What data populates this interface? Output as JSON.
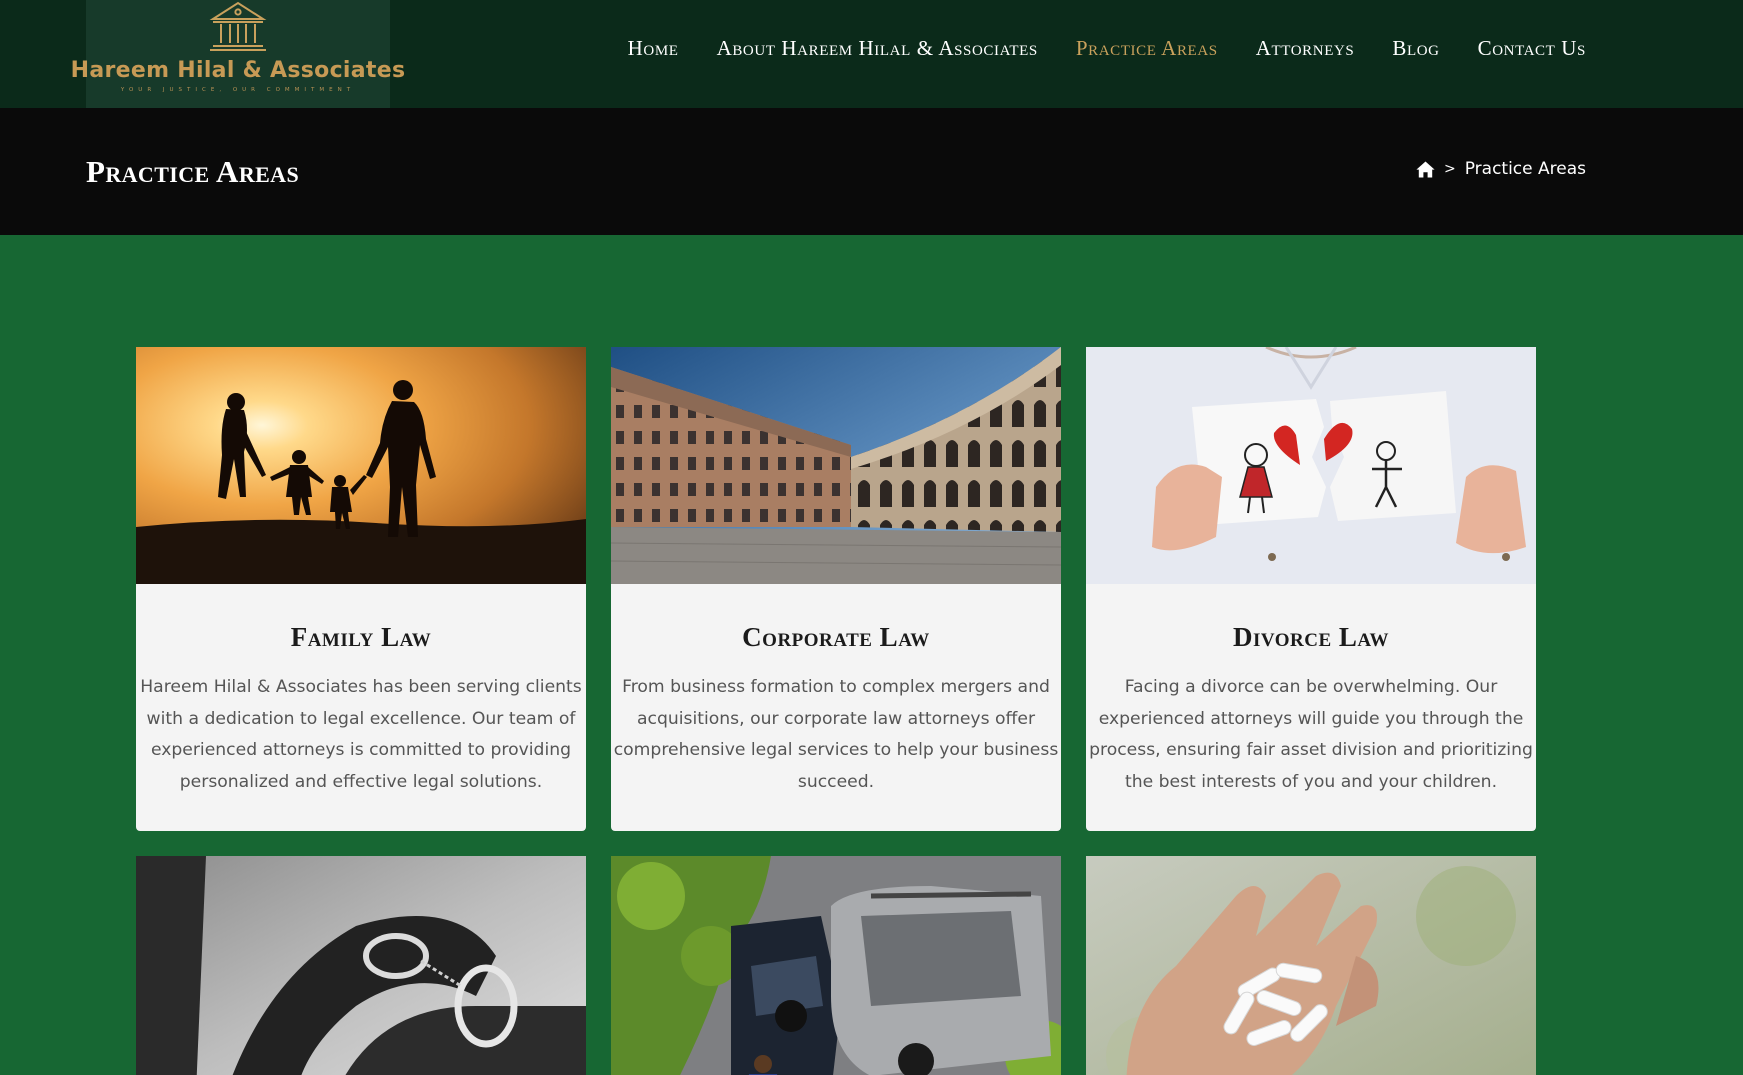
{
  "header": {
    "logo_name": "Hareem Hilal & Associates",
    "logo_tagline": "YOUR JUSTICE, OUR COMMITMENT",
    "logo_icon": "courthouse-icon",
    "nav": [
      {
        "label": "Home",
        "active": false
      },
      {
        "label": "About Hareem Hilal & Associates",
        "active": false
      },
      {
        "label": "Practice Areas",
        "active": true
      },
      {
        "label": "Attorneys",
        "active": false
      },
      {
        "label": "Blog",
        "active": false
      },
      {
        "label": "Contact Us",
        "active": false
      }
    ]
  },
  "title_band": {
    "title": "Practice Areas",
    "breadcrumb": {
      "home_icon": "home-icon",
      "separator": ">",
      "current": "Practice Areas"
    }
  },
  "cards": [
    {
      "title": "Family Law",
      "text": "Hareem Hilal & Associates has been serving clients with a dedication to legal excellence. Our team of experienced attorneys is committed to providing personalized and effective legal solutions.",
      "image": "family-silhouette-sunset"
    },
    {
      "title": "Corporate Law",
      "text": "From business formation to complex mergers and acquisitions, our corporate law attorneys offer comprehensive legal services to help your business succeed.",
      "image": "palace-courtyard"
    },
    {
      "title": "Divorce Law",
      "text": "Facing a divorce can be overwhelming. Our experienced attorneys will guide you through the process, ensuring fair asset division and prioritizing the best interests of you and your children.",
      "image": "child-torn-drawing"
    },
    {
      "title": "",
      "text": "",
      "image": "handcuffed-hands"
    },
    {
      "title": "",
      "text": "",
      "image": "car-collision"
    },
    {
      "title": "",
      "text": "",
      "image": "pills-in-hand"
    }
  ],
  "colors": {
    "header_bg": "#0b2a1a",
    "logo_bg": "#173a2a",
    "accent_gold": "#c9a15c",
    "title_band_bg": "#0a0a0a",
    "page_bg": "#176733",
    "card_bg": "#f4f4f4"
  }
}
